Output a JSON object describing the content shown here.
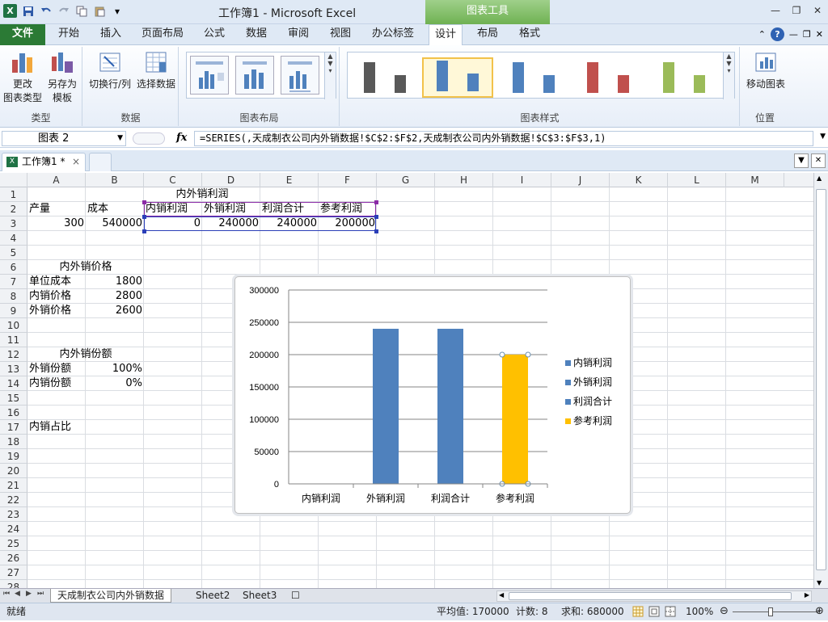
{
  "app": {
    "title": "工作簿1 - Microsoft Excel",
    "context_tab": "图表工具",
    "logo": "X"
  },
  "tabs": [
    {
      "label": "文件"
    },
    {
      "label": "开始"
    },
    {
      "label": "插入"
    },
    {
      "label": "页面布局"
    },
    {
      "label": "公式"
    },
    {
      "label": "数据"
    },
    {
      "label": "审阅"
    },
    {
      "label": "视图"
    },
    {
      "label": "办公标签"
    },
    {
      "label": "设计"
    },
    {
      "label": "布局"
    },
    {
      "label": "格式"
    }
  ],
  "active_tab": "设计",
  "ribbon": {
    "groups": {
      "type": "类型",
      "data": "数据",
      "layout": "图表布局",
      "styles": "图表样式",
      "position": "位置"
    },
    "buttons": {
      "change_type": [
        "更改",
        "图表类型"
      ],
      "save_template": [
        "另存为",
        "模板"
      ],
      "switch_row_col": "切换行/列",
      "select_data": "选择数据",
      "move_chart": "移动图表"
    },
    "style_colors": [
      "#595959",
      "#4f81bd",
      "#4f81bd",
      "#c0504d",
      "#9bbb59"
    ]
  },
  "formula_bar": {
    "name_box": "图表 2",
    "fx": "fx",
    "formula": "=SERIES(,天成制衣公司内外销数据!$C$2:$F$2,天成制衣公司内外销数据!$C$3:$F$3,1)"
  },
  "workbook_tab": {
    "label": "工作簿1 *",
    "close": "×"
  },
  "columns": [
    "A",
    "B",
    "C",
    "D",
    "E",
    "F",
    "G",
    "H",
    "I",
    "J",
    "K",
    "L",
    "M"
  ],
  "rows": [
    "1",
    "2",
    "3",
    "4",
    "5",
    "6",
    "7",
    "8",
    "9",
    "10",
    "11",
    "12",
    "13",
    "14",
    "15",
    "16",
    "17",
    "18",
    "19",
    "20",
    "21",
    "22",
    "23",
    "24",
    "25",
    "26",
    "27",
    "28"
  ],
  "cells": {
    "C1": "内外销利润",
    "A2": "产量",
    "B2": "成本",
    "C2": "内销利润",
    "D2": "外销利润",
    "E2": "利润合计",
    "F2": "参考利润",
    "A3": "300",
    "B3": "540000",
    "C3": "0",
    "D3": "240000",
    "E3": "240000",
    "F3": "200000",
    "A6": "内外销价格",
    "A7": "单位成本",
    "B7": "1800",
    "A8": "内销价格",
    "B8": "2800",
    "A9": "外销价格",
    "B9": "2600",
    "A12": "内外销份额",
    "A13": "外销份额",
    "B13": "100%",
    "A14": "内销份额",
    "B14": "0%",
    "A17": "内销占比"
  },
  "chart_data": {
    "type": "bar",
    "categories": [
      "内销利润",
      "外销利润",
      "利润合计",
      "参考利润"
    ],
    "values": [
      0,
      240000,
      240000,
      200000
    ],
    "bar_colors": [
      "#4f81bd",
      "#4f81bd",
      "#4f81bd",
      "#ffc000"
    ],
    "ylim": [
      0,
      300000
    ],
    "yticks": [
      "300000",
      "250000",
      "200000",
      "150000",
      "100000",
      "50000",
      "0"
    ],
    "grid": true,
    "legend": {
      "placement": "right",
      "entries": [
        {
          "label": "内销利润",
          "color": "#4f81bd"
        },
        {
          "label": "外销利润",
          "color": "#4f81bd"
        },
        {
          "label": "利润合计",
          "color": "#4f81bd"
        },
        {
          "label": "参考利润",
          "color": "#ffc000"
        }
      ]
    },
    "selected_point": "参考利润"
  },
  "sheets": [
    "天成制衣公司内外销数据",
    "Sheet2",
    "Sheet3"
  ],
  "status": {
    "ready": "就绪",
    "average": "平均值: 170000",
    "count": "计数: 8",
    "sum": "求和: 680000",
    "zoom": "100%"
  }
}
